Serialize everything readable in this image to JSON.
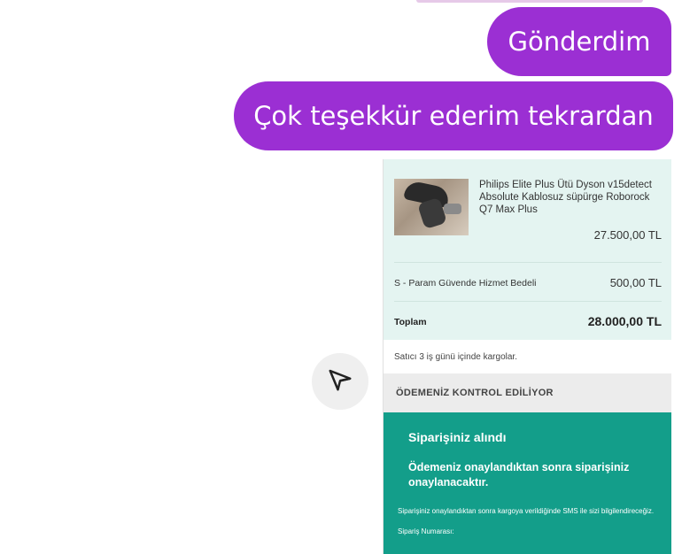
{
  "chat": {
    "messages": [
      {
        "text": "Gönderdim"
      },
      {
        "text": "Çok teşekkür ederim tekrardan"
      }
    ],
    "share_icon": "send-icon"
  },
  "order_card": {
    "product": {
      "name": "Philips Elite Plus Ütü Dyson v15detect Absolute Kablosuz süpürge Roborock Q7 Max Plus",
      "price": "27.500,00 TL",
      "image": "product-photo"
    },
    "fee": {
      "label": "S - Param Güvende Hizmet Bedeli",
      "value": "500,00 TL"
    },
    "total": {
      "label": "Toplam",
      "value": "28.000,00 TL"
    },
    "shipping_note": "Satıcı 3 iş günü içinde kargolar.",
    "status": "ÖDEMENİZ KONTROL EDİLİYOR",
    "success": {
      "title": "Siparişiniz alındı",
      "body": "Ödemeniz onaylandıktan sonra siparişiniz onaylanacaktır.",
      "note": "Siparişiniz onaylandıktan sonra kargoya verildiğinde SMS ile sizi bilgilendireceğiz.",
      "order_number_label": "Sipariş Numarası:"
    },
    "colors": {
      "accent_bubble": "#9b2fd3",
      "mint_bg": "#e4f4f1",
      "success_bg": "#139e8a"
    }
  }
}
